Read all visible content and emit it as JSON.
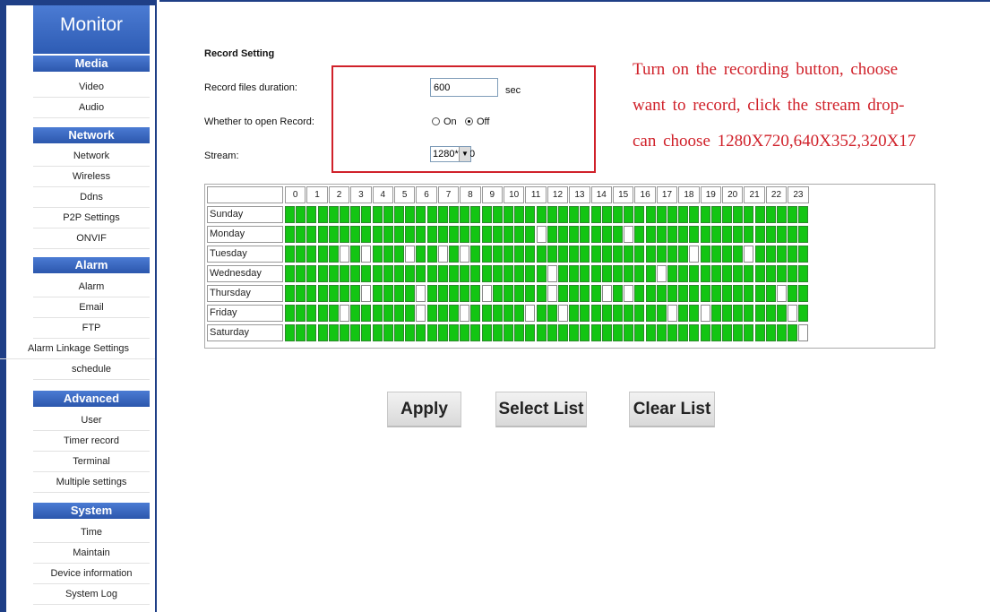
{
  "sidebar": {
    "title": "Monitor",
    "sections": [
      {
        "header": "Media",
        "items": [
          "Video",
          "Audio"
        ]
      },
      {
        "header": "Network",
        "items": [
          "Network",
          "Wireless",
          "Ddns",
          "P2P Settings",
          "ONVIF"
        ]
      },
      {
        "header": "Alarm",
        "items": [
          "Alarm",
          "Email",
          "FTP",
          "Alarm Linkage Settings",
          "schedule"
        ]
      },
      {
        "header": "Advanced",
        "items": [
          "User",
          "Timer record",
          "Terminal",
          "Multiple settings"
        ]
      },
      {
        "header": "System",
        "items": [
          "Time",
          "Maintain",
          "Device information",
          "System Log"
        ]
      }
    ]
  },
  "record": {
    "section_title": "Record Setting",
    "duration_label": "Record files duration:",
    "duration_value": "600",
    "duration_unit": "sec",
    "open_label": "Whether to open Record:",
    "on_label": "On",
    "off_label": "Off",
    "selected": "Off",
    "stream_label": "Stream:",
    "stream_value": "1280*720"
  },
  "note_lines": [
    "Turn on the recording button, choose",
    "want to record, click the stream drop-",
    "can choose 1280X720,640X352,320X17"
  ],
  "schedule": {
    "hours": [
      "0",
      "1",
      "2",
      "3",
      "4",
      "5",
      "6",
      "7",
      "8",
      "9",
      "10",
      "11",
      "12",
      "13",
      "14",
      "15",
      "16",
      "17",
      "18",
      "19",
      "20",
      "21",
      "22",
      "23"
    ],
    "days": [
      "Sunday",
      "Monday",
      "Tuesday",
      "Wednesday",
      "Thursday",
      "Friday",
      "Saturday"
    ],
    "unselected_slots": [
      [],
      [
        23,
        31
      ],
      [
        5,
        7,
        11,
        14,
        16,
        37,
        42
      ],
      [
        24,
        34
      ],
      [
        7,
        12,
        18,
        24,
        29,
        31,
        45
      ],
      [
        5,
        12,
        16,
        22,
        25,
        35,
        38,
        46
      ],
      [
        47
      ]
    ]
  },
  "buttons": {
    "apply": "Apply",
    "select_list": "Select List",
    "clear_list": "Clear List"
  },
  "colors": {
    "nav_blue": "#2e5cb4",
    "selected_slot": "#13c513",
    "note_red": "#d0212a"
  }
}
